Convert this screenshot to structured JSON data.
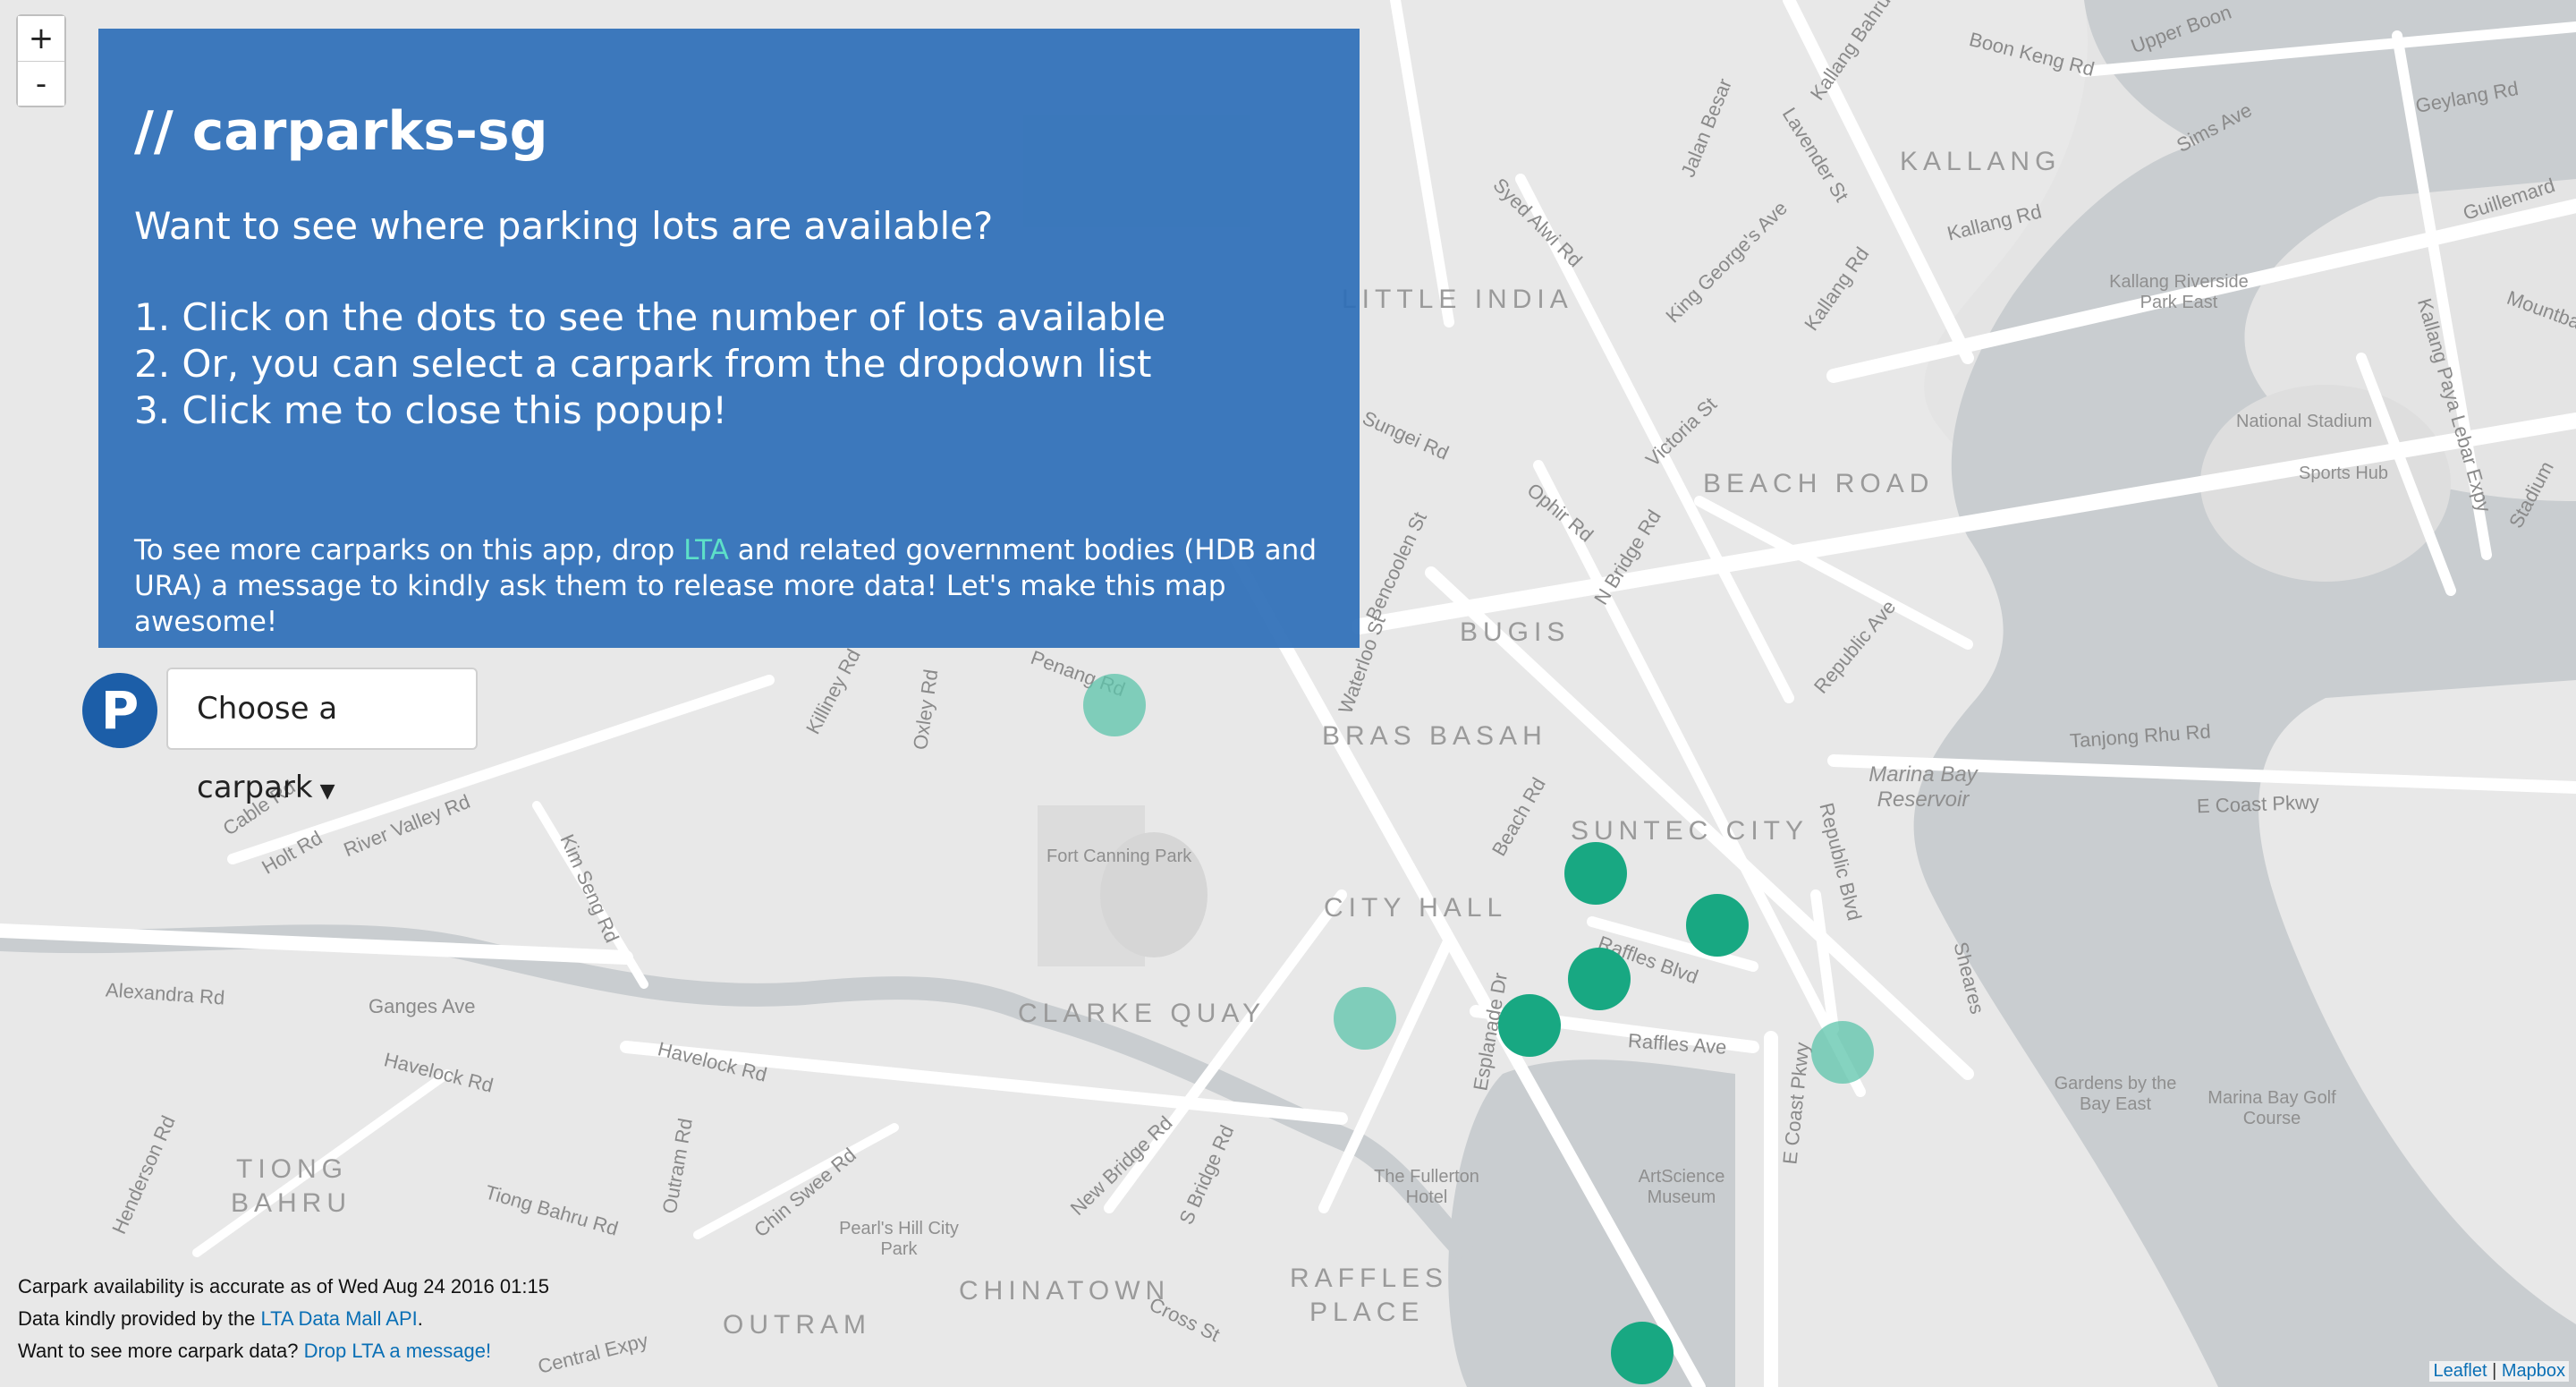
{
  "zoom": {
    "in_label": "+",
    "out_label": "-"
  },
  "popup": {
    "title": "// carparks-sg",
    "question": "Want to see where parking lots are available?",
    "steps": [
      "1. Click on the dots to see the number of lots available",
      "2. Or, you can select a carpark from the dropdown list",
      "3. Click me to close this popup!"
    ],
    "note_before": "To see more carparks on this app, drop ",
    "note_link": "LTA",
    "note_after": " and related government bodies (HDB and URA) a message to kindly ask them to release more data! Let's make this map awesome!"
  },
  "selector": {
    "icon_letter": "P",
    "placeholder": "Choose a carpark"
  },
  "map_labels": {
    "districts": [
      "KALLANG",
      "LITTLE INDIA",
      "BEACH ROAD",
      "BUGIS",
      "BRAS BASAH",
      "SUNTEC CITY",
      "CITY HALL",
      "CLARKE QUAY",
      "TIONG",
      "BAHRU",
      "OUTRAM",
      "CHINATOWN",
      "RAFFLES",
      "PLACE"
    ],
    "streets": [
      "Boon Keng Rd",
      "Upper Boon",
      "Geylang Rd",
      "Sims Ave",
      "Guillemard",
      "Kallang Rd",
      "Kallang Bahru",
      "Lavender St",
      "Jalan Besar",
      "Syed Alwi Rd",
      "King George's Ave",
      "Kallang Rd",
      "Kallang Paya Lebar Expy",
      "Mountbatten",
      "Sungei Rd",
      "Victoria St",
      "Ophir Rd",
      "N Bridge Rd",
      "Bencoolen St",
      "Waterloo St",
      "Republic Ave",
      "Tanjong Rhu Rd",
      "E Coast Pkwy",
      "Penang Rd",
      "Killiney Rd",
      "Oxley Rd",
      "Beach Rd",
      "Republic Blvd",
      "Raffles Blvd",
      "Raffles Ave",
      "E Coast Pkwy",
      "Cable Rd",
      "Holt Rd",
      "River Valley Rd",
      "Kim Seng Rd",
      "Alexandra Rd",
      "Ganges Ave",
      "Havelock Rd",
      "Havelock Rd",
      "Esplanade Dr",
      "New Bridge Rd",
      "S Bridge Rd",
      "Chin Swee Rd",
      "Outram Rd",
      "Tiong Bahru Rd",
      "Henderson Rd",
      "Cross St",
      "Central Expy",
      "Sheares",
      "Stadium"
    ],
    "pois": [
      "Kallang Riverside Park East",
      "National Stadium",
      "Sports Hub",
      "Marina Bay Reservoir",
      "Fort Canning Park",
      "Gardens by the Bay East",
      "Marina Bay Golf Course",
      "The Fullerton Hotel",
      "ArtScience Museum",
      "Pearl's Hill City Park"
    ]
  },
  "carpark_dots": [
    {
      "id": "dot-1",
      "faded": true
    },
    {
      "id": "dot-2",
      "faded": false
    },
    {
      "id": "dot-3",
      "faded": false
    },
    {
      "id": "dot-4",
      "faded": false
    },
    {
      "id": "dot-5",
      "faded": false
    },
    {
      "id": "dot-6",
      "faded": true
    },
    {
      "id": "dot-7",
      "faded": true
    },
    {
      "id": "dot-8",
      "faded": false
    }
  ],
  "info": {
    "line1": "Carpark availability is accurate as of Wed Aug 24 2016 01:15",
    "line2_before": "Data kindly provided by the ",
    "line2_link": "LTA Data Mall API",
    "line2_after": ".",
    "line3_before": "Want to see more carpark data? ",
    "line3_link": "Drop LTA a message!"
  },
  "attribution": {
    "leaflet": "Leaflet",
    "sep": "|",
    "mapbox": "Mapbox"
  },
  "colors": {
    "popup_bg": "#2c6eb7",
    "dot": "#18a882",
    "link": "#0a6fb5",
    "water": "#c9cdd0",
    "land": "#e8e8e8"
  }
}
